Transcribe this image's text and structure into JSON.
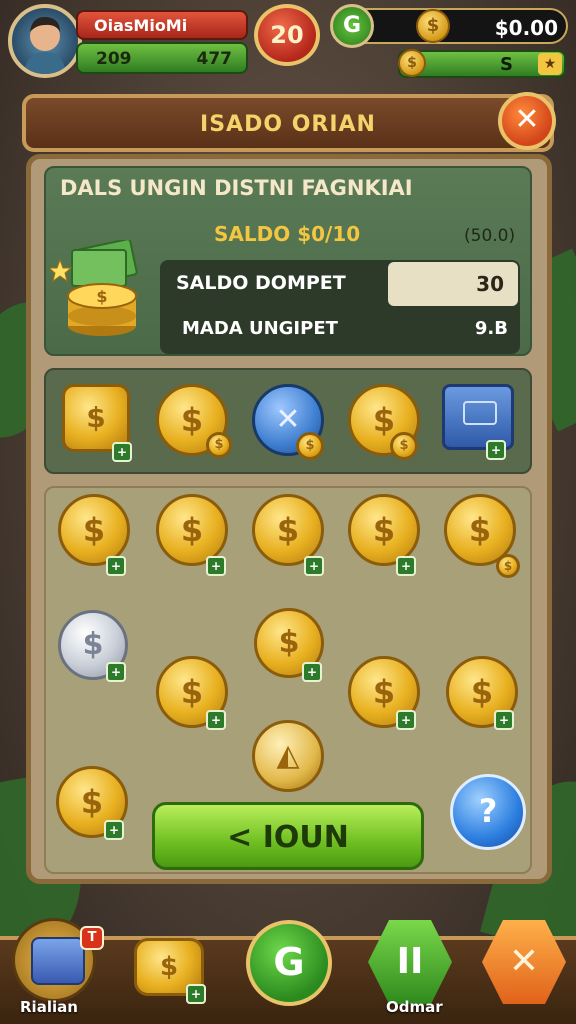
{
  "player": {
    "name": "OiasMioMi",
    "level": "20",
    "xp_left": "209",
    "xp_right": "477"
  },
  "currency": {
    "main_balance": "$0.00",
    "sub_balance": "S",
    "g_button": "G",
    "coin_symbol": "$"
  },
  "panel": {
    "title": "ISADO ORIAN",
    "heading": "DALS UNGIN DISTNI FAGNKIAI",
    "saldo_text": "SALDO $0/10",
    "saldo_right": "(50.0)",
    "row1_label": "SALDO DOMPET",
    "row1_value": "30",
    "row2_label": "MADA UNGIPET",
    "row2_value": "9.B"
  },
  "join_button": {
    "label": "< IOUN"
  },
  "blue_button": {
    "label": "?"
  },
  "bottom_nav": {
    "left_label": "Rialian",
    "left_badge": "T",
    "center_label": "Odmar",
    "close_symbol": "✕",
    "refresh_symbol": "G",
    "pause_symbol": "II"
  },
  "colors": {
    "accent_gold": "#f2c640",
    "green": "#6fbf22",
    "red": "#d2441a",
    "wood": "#7a4a2a"
  }
}
